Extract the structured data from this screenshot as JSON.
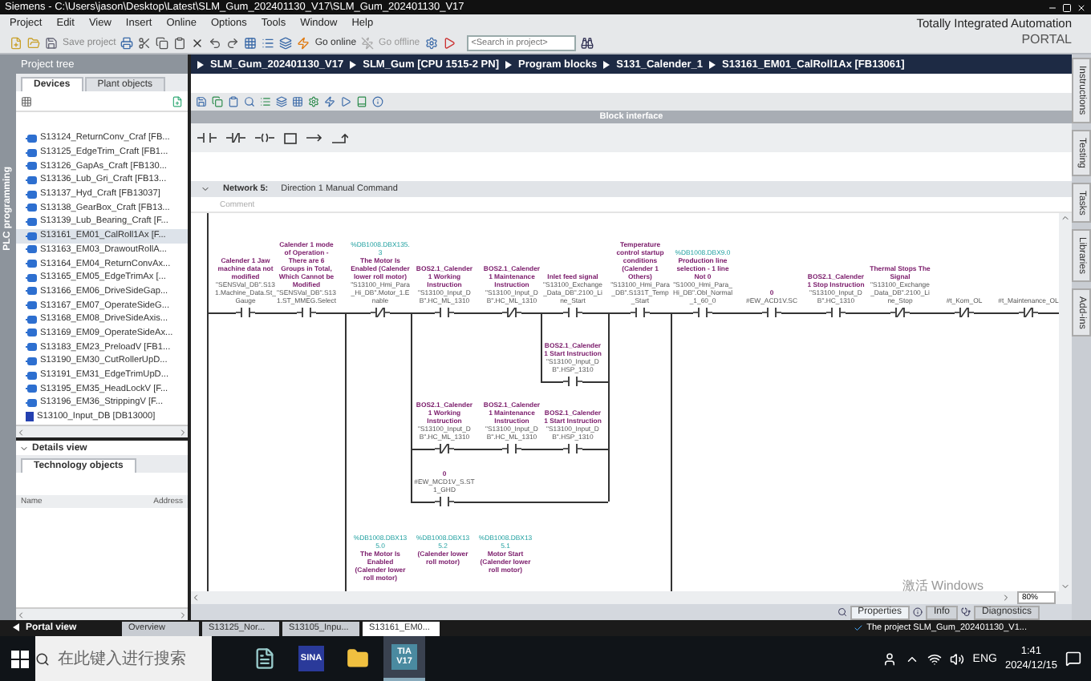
{
  "window": {
    "title": "Siemens - C:\\Users\\jason\\Desktop\\Latest\\SLM_Gum_202401130_V17\\SLM_Gum_202401130_V17"
  },
  "menu": [
    "Project",
    "Edit",
    "View",
    "Insert",
    "Online",
    "Options",
    "Tools",
    "Window",
    "Help"
  ],
  "brand": {
    "line1": "Totally Integrated Automation",
    "line2": "PORTAL"
  },
  "toolbar": {
    "save": "Save project",
    "go_online": "Go online",
    "go_offline": "Go offline",
    "search": {
      "placeholder": "<Search in project>"
    }
  },
  "side_tab": "PLC programming",
  "project_tree": {
    "title": "Project tree",
    "tabs": [
      {
        "label": "Devices",
        "selected": true
      },
      {
        "label": "Plant objects",
        "selected": false
      }
    ],
    "items": [
      {
        "label": "S13124_ReturnConv_Craf [FB...",
        "kind": "fb",
        "selected": false
      },
      {
        "label": "S13125_EdgeTrim_Craft [FB1...",
        "kind": "fb",
        "selected": false
      },
      {
        "label": "S13126_GapAs_Craft [FB130...",
        "kind": "fb",
        "selected": false
      },
      {
        "label": "S13136_Lub_Gri_Craft [FB13...",
        "kind": "fb",
        "selected": false
      },
      {
        "label": "S13137_Hyd_Craft [FB13037]",
        "kind": "fb",
        "selected": false
      },
      {
        "label": "S13138_GearBox_Craft [FB13...",
        "kind": "fb",
        "selected": false
      },
      {
        "label": "S13139_Lub_Bearing_Craft [F...",
        "kind": "fb",
        "selected": false
      },
      {
        "label": "S13161_EM01_CalRoll1Ax [F...",
        "kind": "fb",
        "selected": true
      },
      {
        "label": "S13163_EM03_DrawoutRollA...",
        "kind": "fb",
        "selected": false
      },
      {
        "label": "S13164_EM04_ReturnConvAx...",
        "kind": "fb",
        "selected": false
      },
      {
        "label": "S13165_EM05_EdgeTrimAx [...",
        "kind": "fb",
        "selected": false
      },
      {
        "label": "S13166_EM06_DriveSideGap...",
        "kind": "fb",
        "selected": false
      },
      {
        "label": "S13167_EM07_OperateSideG...",
        "kind": "fb",
        "selected": false
      },
      {
        "label": "S13168_EM08_DriveSideAxis...",
        "kind": "fb",
        "selected": false
      },
      {
        "label": "S13169_EM09_OperateSideAx...",
        "kind": "fb",
        "selected": false
      },
      {
        "label": "S13183_EM23_PreloadV [FB1...",
        "kind": "fb",
        "selected": false
      },
      {
        "label": "S13190_EM30_CutRollerUpD...",
        "kind": "fb",
        "selected": false
      },
      {
        "label": "S13191_EM31_EdgeTrimUpD...",
        "kind": "fb",
        "selected": false
      },
      {
        "label": "S13195_EM35_HeadLockV [F...",
        "kind": "fb",
        "selected": false
      },
      {
        "label": "S13196_EM36_StrippingV [F...",
        "kind": "fb",
        "selected": false
      },
      {
        "label": "S13100_Input_DB [DB13000]",
        "kind": "db",
        "selected": false
      }
    ]
  },
  "details_view": {
    "title": "Details view",
    "tab": "Technology objects",
    "columns": [
      "Name",
      "Address"
    ]
  },
  "breadcrumb": [
    "SLM_Gum_202401130_V17",
    "SLM_Gum [CPU 1515-2 PN]",
    "Program blocks",
    "S131_Calender_1",
    "S13161_EM01_CalRoll1Ax [FB13061]"
  ],
  "block_interface": "Block interface",
  "network": {
    "label": "Network 5:",
    "title": "Direction 1 Manual Command",
    "comment": "Comment",
    "contacts": [
      {
        "kind": "no",
        "comment": "Calender 1 Jaw machine data not modified",
        "address": "\"SENSVal_DB\".S131.Machine_Data.St_Gauge"
      },
      {
        "kind": "no",
        "comment": "Calender 1 mode of Operation - There are 6 Groups in Total, Which Cannot be Modified",
        "address": "\"SENSVal_DB\".S131.ST_MMEG.Select"
      },
      {
        "kind": "nc",
        "operand": "%DB1008.DBX135.3",
        "comment": "The Motor Is Enabled (Calender lower roll motor)",
        "address": "\"S13100_Hmi_Para_Hi_DB\".Motor_1.Enable"
      },
      {
        "kind": "no",
        "comment": "BOS2.1_Calender 1 Working Instruction",
        "address": "\"S13100_Input_DB\".HC_ML_1310"
      },
      {
        "kind": "nc",
        "comment": "BOS2.1_Calender 1 Maintenance Instruction",
        "address": "\"S13100_Input_DB\".HC_ML_1310"
      },
      {
        "kind": "no",
        "comment": "Inlet feed signal",
        "address": "\"S13100_Exchange_Data_DB\".2100_Line_Start"
      },
      {
        "kind": "no",
        "comment": "Temperature control startup conditions (Calender 1 Others)",
        "address": "\"S13100_Hmi_Para_DB\".S131T_Temp_Start"
      },
      {
        "kind": "no",
        "operand": "%DB1008.DBX9.0",
        "comment": "Production line selection - 1 line Not 0",
        "address": "\"S1000_Hmi_Para_Hi_DB\".Obl_Normal_1_60_0"
      },
      {
        "kind": "no",
        "comment": "0",
        "address": "#EW_ACD1V.SC"
      },
      {
        "kind": "no",
        "comment": "BOS2.1_Calender 1 Stop Instruction",
        "address": "\"S13100_Input_DB\".HC_1310"
      },
      {
        "kind": "nc",
        "comment": "Thermal Stops The Signal",
        "address": "\"S13100_Exchange_Data_DB\".2100_Line_Stop"
      },
      {
        "kind": "nc",
        "address": "#t_Kom_OL"
      },
      {
        "kind": "nc",
        "address": "#t_Maintenance_OL"
      },
      {
        "kind": "no",
        "comment": "BOS2.1_Calender 1 Start Instruction",
        "address": "\"S13100_Input_DB\".HSP_1310"
      },
      {
        "kind": "nc",
        "comment": "BOS2.1_Calender 1 Working Instruction",
        "address": "\"S13100_Input_DB\".HC_ML_1310"
      },
      {
        "kind": "no",
        "comment": "BOS2.1_Calender 1 Maintenance Instruction",
        "address": "\"S13100_Input_DB\".HC_ML_1310"
      },
      {
        "kind": "no",
        "comment": "BOS2.1_Calender 1 Start Instruction",
        "address": "\"S13100_Input_DB\".HSP_1310"
      },
      {
        "kind": "no",
        "comment": "0",
        "address": "#EW_MCD1V_S.ST1_GHD"
      },
      {
        "kind": "label",
        "operand": "%DB1008.DBX135.0",
        "comment": "The Motor Is Enabled (Calender lower roll motor)"
      },
      {
        "kind": "label",
        "operand": "%DB1008.DBX135.2",
        "comment": "(Calender lower roll motor)"
      },
      {
        "kind": "label",
        "operand": "%DB1008.DBX135.1",
        "comment": "Motor Start (Calender lower roll motor)"
      }
    ]
  },
  "zoom": "80%",
  "right_tabs": [
    "Instructions",
    "Testing",
    "Tasks",
    "Libraries",
    "Add-ins"
  ],
  "watermark_text": "激活 Windows",
  "inspector_tabs": [
    {
      "label": "Properties",
      "selected": true
    },
    {
      "label": "Info",
      "selected": false
    },
    {
      "label": "Diagnostics",
      "selected": false
    }
  ],
  "portal_view": "Portal view",
  "editor_tabs": [
    {
      "label": "Overview",
      "selected": false
    },
    {
      "label": "S13125_Nor...",
      "selected": false
    },
    {
      "label": "S13105_Inpu...",
      "selected": false
    },
    {
      "label": "S13161_EM0...",
      "selected": true
    }
  ],
  "status": "The project SLM_Gum_202401130_V1...",
  "taskbar": {
    "search": {
      "placeholder": "在此键入进行搜索"
    },
    "apps": [
      {
        "kind": "notepad"
      },
      {
        "kind": "sina",
        "label": "SINA"
      },
      {
        "kind": "folder"
      },
      {
        "kind": "tia",
        "label": "TIA V17",
        "selected": true
      }
    ],
    "language": "ENG",
    "time": "1:41",
    "date": "2024/12/15"
  }
}
